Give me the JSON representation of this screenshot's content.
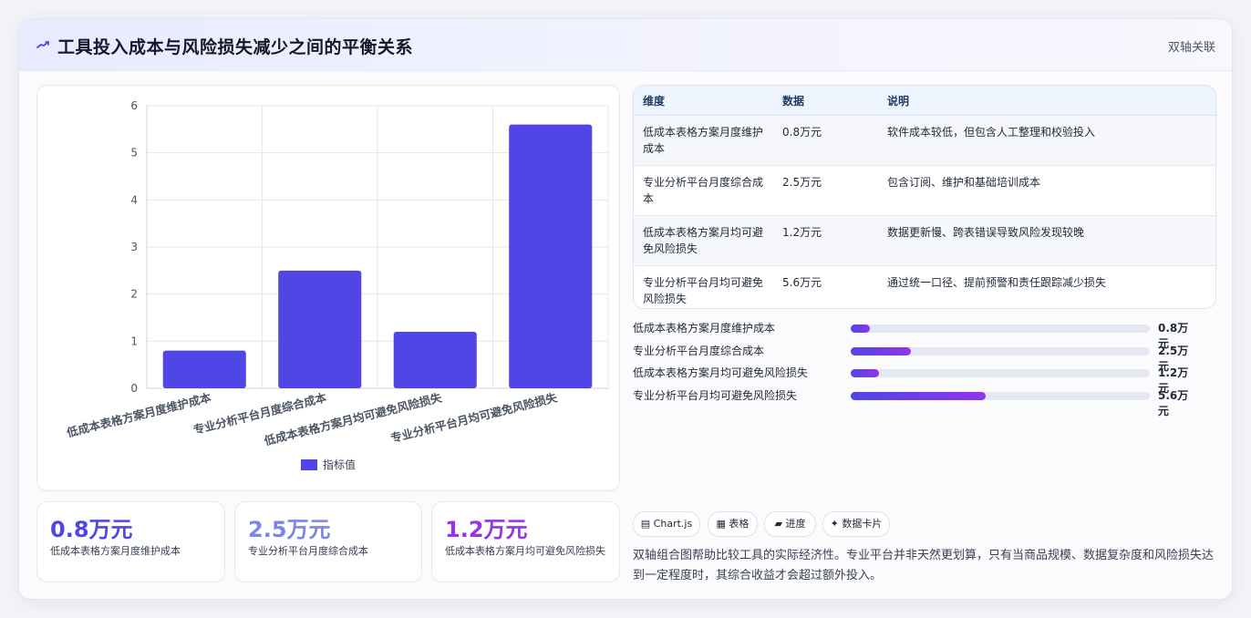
{
  "header": {
    "title": "工具投入成本与风险损失减少之间的平衡关系",
    "tag": "双轴关联",
    "icon": "trend-icon"
  },
  "chart_data": {
    "type": "bar",
    "categories": [
      "低成本表格方案月度维护成本",
      "专业分析平台月度综合成本",
      "低成本表格方案月均可避免风险损失",
      "专业分析平台月均可避免风险损失"
    ],
    "series": [
      {
        "name": "指标值",
        "values": [
          0.8,
          2.5,
          1.2,
          5.6
        ],
        "color": "#5046e5"
      }
    ],
    "ylim": [
      0,
      6
    ],
    "yticks": [
      "0",
      "1",
      "2",
      "3",
      "4",
      "5",
      "6"
    ],
    "legend": "bottom",
    "grid": true
  },
  "table": {
    "headers": [
      "维度",
      "数据",
      "说明"
    ],
    "rows": [
      [
        "低成本表格方案月度维护成本",
        "0.8万元",
        "软件成本较低，但包含人工整理和校验投入"
      ],
      [
        "专业分析平台月度综合成本",
        "2.5万元",
        "包含订阅、维护和基础培训成本"
      ],
      [
        "低成本表格方案月均可避免风险损失",
        "1.2万元",
        "数据更新慢、跨表错误导致风险发现较晚"
      ],
      [
        "专业分析平台月均可避免风险损失",
        "5.6万元",
        "通过统一口径、提前预警和责任跟踪减少损失"
      ]
    ]
  },
  "progress": [
    {
      "label": "低成本表格方案月度维护成本",
      "value": "0.8万元",
      "fraction": 0.0625
    },
    {
      "label": "专业分析平台月度综合成本",
      "value": "2.5万元",
      "fraction": 0.2
    },
    {
      "label": "低成本表格方案月均可避免风险损失",
      "value": "1.2万元",
      "fraction": 0.095
    },
    {
      "label": "专业分析平台月均可避免风险损失",
      "value": "5.6万元",
      "fraction": 0.45
    }
  ],
  "stats": [
    {
      "value": "0.8万元",
      "label": "低成本表格方案月度维护成本",
      "color": "#4f46e5"
    },
    {
      "value": "2.5万元",
      "label": "专业分析平台月度综合成本",
      "color": "#7b86e8"
    },
    {
      "value": "1.2万元",
      "label": "低成本表格方案月均可避免风险损失",
      "color": "#9333ea"
    }
  ],
  "chips": [
    "▤ Chart.js",
    "▦ 表格",
    "▰ 进度",
    "✦ 数据卡片"
  ],
  "note": "双轴组合图帮助比较工具的实际经济性。专业平台并非天然更划算，只有当商品规模、数据复杂度和风险损失达到一定程度时，其综合收益才会超过额外投入。",
  "colors": {
    "bar": "#5046e5",
    "progress_start": "#4f46e5",
    "progress_end": "#9333ea"
  }
}
